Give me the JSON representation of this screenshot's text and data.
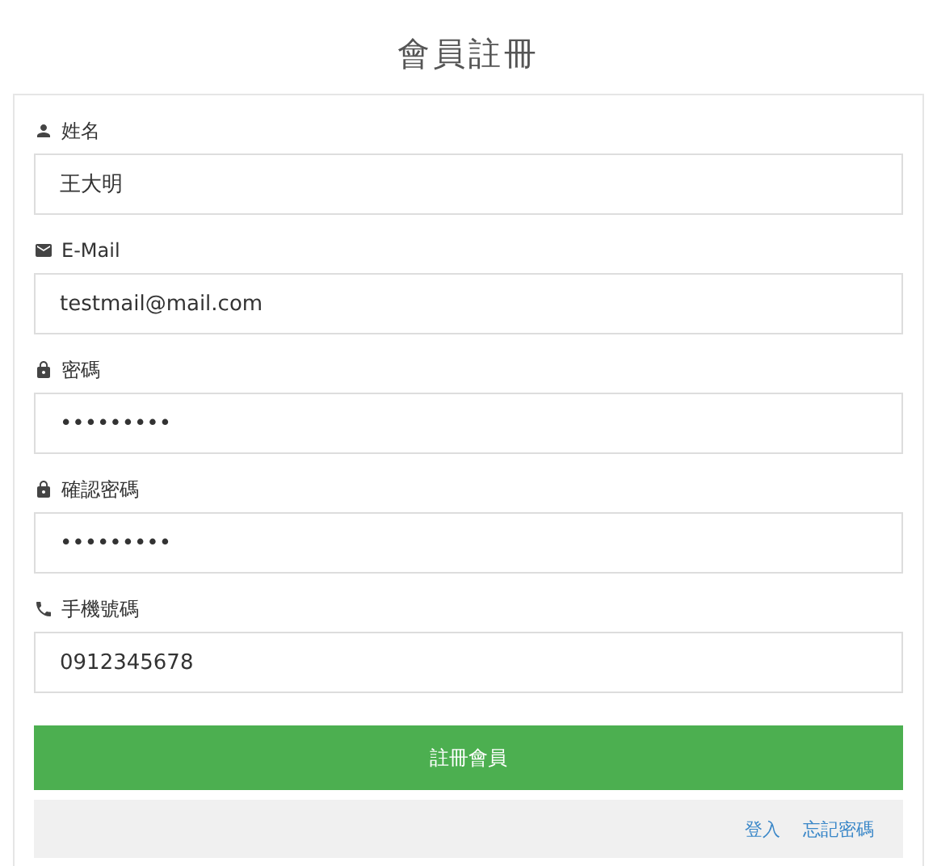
{
  "title": "會員註冊",
  "fields": [
    {
      "kind": "user",
      "label": "姓名",
      "value": "王大明"
    },
    {
      "kind": "mail",
      "label": "E-Mail",
      "value": "testmail@mail.com"
    },
    {
      "kind": "lock",
      "label": "密碼",
      "value": "•••••••••"
    },
    {
      "kind": "lock",
      "label": "確認密碼",
      "value": "•••••••••"
    },
    {
      "kind": "phone",
      "label": "手機號碼",
      "value": "0912345678"
    }
  ],
  "submit_button": "註冊會員",
  "links": [
    "登入",
    "忘記密碼"
  ]
}
